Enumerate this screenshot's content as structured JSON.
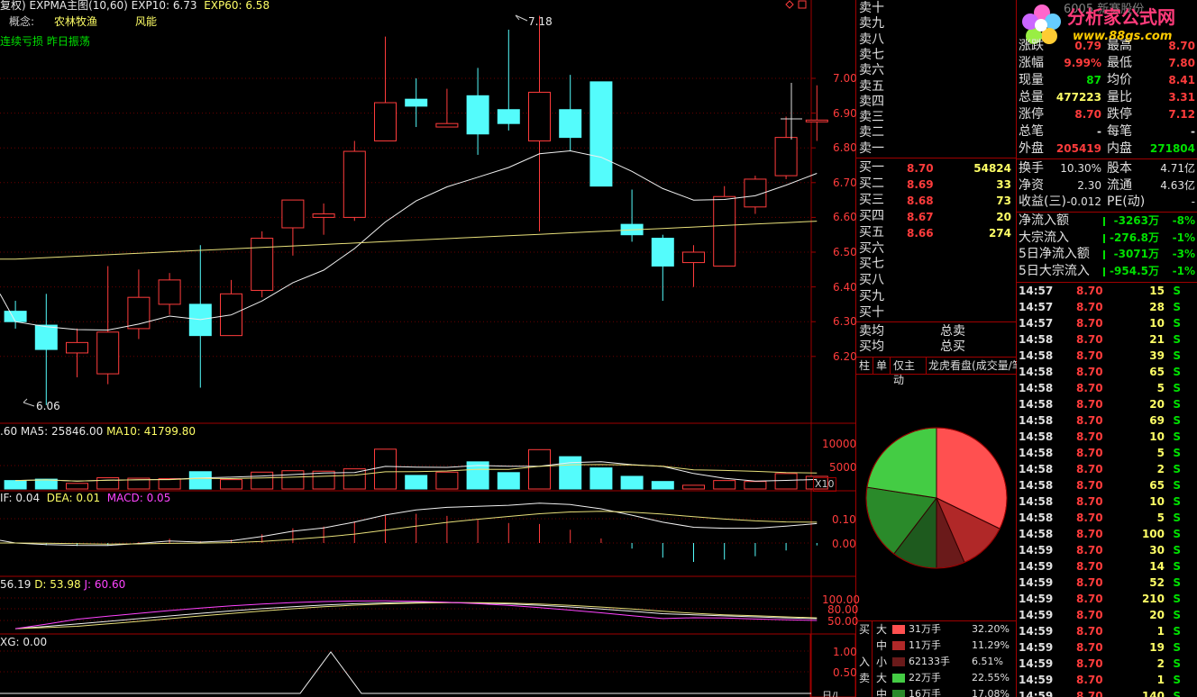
{
  "chart_header": {
    "title": "复权) EXPMA主图(10,60)",
    "exp10": "EXP10: 6.73",
    "exp60": "EXP60: 6.58",
    "concept_label": "概念:",
    "concept1": "农林牧渔",
    "concept2": "风能",
    "tag": "连续亏损 昨日振荡"
  },
  "price_axis": [
    "7.00",
    "6.90",
    "6.80",
    "6.70",
    "6.60",
    "6.50",
    "6.40",
    "6.30",
    "6.20"
  ],
  "high_label": "7.18",
  "low_label": "6.06",
  "volume_header": {
    "a": ".60",
    "ma5": "MA5: 25846.00",
    "ma10": "MA10: 41799.80"
  },
  "volume_axis": [
    "10000",
    "5000"
  ],
  "volume_unit": "X10",
  "macd_header": {
    "dif": "IF: 0.04",
    "dea": "DEA: 0.01",
    "macd": "MACD: 0.05"
  },
  "macd_axis": [
    "0.10",
    "0.00"
  ],
  "kdj_header": {
    "k": "56.19",
    "d": "D: 53.98",
    "j": "J: 60.60"
  },
  "kdj_axis": [
    "100.00",
    "80.00",
    "50.00"
  ],
  "xg_header": "XG: 0.00",
  "xg_axis": [
    "1.00",
    "0.50"
  ],
  "bottom_right_corner": "日/l",
  "sell_levels": [
    "卖十",
    "卖九",
    "卖八",
    "卖七",
    "卖六",
    "卖五",
    "卖四",
    "卖三",
    "卖二",
    "卖一"
  ],
  "buy_levels": [
    {
      "label": "买一",
      "price": "8.70",
      "vol": "54824"
    },
    {
      "label": "买二",
      "price": "8.69",
      "vol": "33"
    },
    {
      "label": "买三",
      "price": "8.68",
      "vol": "73"
    },
    {
      "label": "买四",
      "price": "8.67",
      "vol": "20"
    },
    {
      "label": "买五",
      "price": "8.66",
      "vol": "274"
    },
    {
      "label": "买六",
      "price": "",
      "vol": ""
    },
    {
      "label": "买七",
      "price": "",
      "vol": ""
    },
    {
      "label": "买八",
      "price": "",
      "vol": ""
    },
    {
      "label": "买九",
      "price": "",
      "vol": ""
    },
    {
      "label": "买十",
      "price": "",
      "vol": ""
    }
  ],
  "avg": {
    "sell_avg": "卖均",
    "sell_total": "总卖",
    "buy_avg": "买均",
    "buy_total": "总买"
  },
  "tabs": [
    "柱",
    "单",
    "仅主动",
    "龙虎看盘(成交量/笔"
  ],
  "flow_legend": [
    {
      "side": "买",
      "size": "大",
      "color": "#ff5050",
      "amount": "31万手",
      "pct": "32.20%"
    },
    {
      "side": "",
      "size": "中",
      "color": "#b02828",
      "amount": "11万手",
      "pct": "11.29%"
    },
    {
      "side": "入",
      "size": "小",
      "color": "#6a1a1a",
      "amount": "62133手",
      "pct": "6.51%"
    },
    {
      "side": "卖",
      "size": "大",
      "color": "#44cc44",
      "amount": "22万手",
      "pct": "22.55%"
    },
    {
      "side": "",
      "size": "中",
      "color": "#2a8a2a",
      "amount": "16万手",
      "pct": "17.08%"
    }
  ],
  "pie_values": [
    32.2,
    11.29,
    6.51,
    10.35,
    17.08,
    22.55
  ],
  "pie_colors": [
    "#ff5050",
    "#b02828",
    "#6a1a1a",
    "#1e5a1e",
    "#2a8a2a",
    "#44cc44"
  ],
  "logo": {
    "text": "分析家公式网",
    "url": "www.88gs.com",
    "back_text": "6005 新赛股份"
  },
  "quote": [
    {
      "l": "涨跌",
      "v": "0.79",
      "l2": "最高",
      "v2": "8.70"
    },
    {
      "l": "涨幅",
      "v": "9.99%",
      "l2": "最低",
      "v2": "7.80"
    },
    {
      "l": "现量",
      "v": "87",
      "l2": "均价",
      "v2": "8.41"
    },
    {
      "l": "总量",
      "v": "477223",
      "l2": "量比",
      "v2": "3.31"
    },
    {
      "l": "涨停",
      "v": "8.70",
      "l2": "跌停",
      "v2": "7.12"
    },
    {
      "l": "总笔",
      "v": "-",
      "l2": "每笔",
      "v2": "-"
    },
    {
      "l": "外盘",
      "v": "205419",
      "l2": "内盘",
      "v2": "271804"
    }
  ],
  "fundamentals": [
    {
      "l": "换手",
      "v": "10.30%",
      "l2": "股本",
      "v2": "4.71亿"
    },
    {
      "l": "净资",
      "v": "2.30",
      "l2": "流通",
      "v2": "4.63亿"
    },
    {
      "l": "收益(三)",
      "v": "-0.012",
      "l2": "PE(动)",
      "v2": "-"
    }
  ],
  "fund_flow": [
    {
      "l": "净流入额",
      "v": "-3263万",
      "p": "-8%"
    },
    {
      "l": "大宗流入",
      "v": "-276.8万",
      "p": "-1%"
    },
    {
      "l": "5日净流入额",
      "v": "-3071万",
      "p": "-3%"
    },
    {
      "l": "5日大宗流入",
      "v": "-954.5万",
      "p": "-1%"
    }
  ],
  "ticks": [
    {
      "t": "14:57",
      "p": "8.70",
      "v": "15",
      "s": "S"
    },
    {
      "t": "14:57",
      "p": "8.70",
      "v": "28",
      "s": "S"
    },
    {
      "t": "14:57",
      "p": "8.70",
      "v": "10",
      "s": "S"
    },
    {
      "t": "14:58",
      "p": "8.70",
      "v": "21",
      "s": "S"
    },
    {
      "t": "14:58",
      "p": "8.70",
      "v": "39",
      "s": "S"
    },
    {
      "t": "14:58",
      "p": "8.70",
      "v": "65",
      "s": "S"
    },
    {
      "t": "14:58",
      "p": "8.70",
      "v": "5",
      "s": "S"
    },
    {
      "t": "14:58",
      "p": "8.70",
      "v": "20",
      "s": "S"
    },
    {
      "t": "14:58",
      "p": "8.70",
      "v": "69",
      "s": "S"
    },
    {
      "t": "14:58",
      "p": "8.70",
      "v": "10",
      "s": "S"
    },
    {
      "t": "14:58",
      "p": "8.70",
      "v": "5",
      "s": "S"
    },
    {
      "t": "14:58",
      "p": "8.70",
      "v": "2",
      "s": "S"
    },
    {
      "t": "14:58",
      "p": "8.70",
      "v": "65",
      "s": "S"
    },
    {
      "t": "14:58",
      "p": "8.70",
      "v": "10",
      "s": "S"
    },
    {
      "t": "14:58",
      "p": "8.70",
      "v": "5",
      "s": "S"
    },
    {
      "t": "14:58",
      "p": "8.70",
      "v": "100",
      "s": "S"
    },
    {
      "t": "14:59",
      "p": "8.70",
      "v": "30",
      "s": "S"
    },
    {
      "t": "14:59",
      "p": "8.70",
      "v": "14",
      "s": "S"
    },
    {
      "t": "14:59",
      "p": "8.70",
      "v": "52",
      "s": "S"
    },
    {
      "t": "14:59",
      "p": "8.70",
      "v": "210",
      "s": "S"
    },
    {
      "t": "14:59",
      "p": "8.70",
      "v": "20",
      "s": "S"
    },
    {
      "t": "14:59",
      "p": "8.70",
      "v": "1",
      "s": "S"
    },
    {
      "t": "14:59",
      "p": "8.70",
      "v": "19",
      "s": "S"
    },
    {
      "t": "14:59",
      "p": "8.70",
      "v": "2",
      "s": "S"
    },
    {
      "t": "14:59",
      "p": "8.70",
      "v": "1",
      "s": "S"
    },
    {
      "t": "14:59",
      "p": "8.70",
      "v": "140",
      "s": "S"
    }
  ],
  "candles": [
    {
      "o": 6.33,
      "c": 6.3,
      "h": 6.36,
      "l": 6.28
    },
    {
      "o": 6.29,
      "c": 6.22,
      "h": 6.38,
      "l": 6.06
    },
    {
      "o": 6.21,
      "c": 6.24,
      "h": 6.28,
      "l": 6.14
    },
    {
      "o": 6.15,
      "c": 6.27,
      "h": 6.46,
      "l": 6.12
    },
    {
      "o": 6.28,
      "c": 6.37,
      "h": 6.45,
      "l": 6.25
    },
    {
      "o": 6.35,
      "c": 6.42,
      "h": 6.44,
      "l": 6.32
    },
    {
      "o": 6.35,
      "c": 6.26,
      "h": 6.52,
      "l": 6.11
    },
    {
      "o": 6.26,
      "c": 6.38,
      "h": 6.42,
      "l": 6.26
    },
    {
      "o": 6.39,
      "c": 6.54,
      "h": 6.56,
      "l": 6.37
    },
    {
      "o": 6.57,
      "c": 6.65,
      "h": 6.65,
      "l": 6.49
    },
    {
      "o": 6.6,
      "c": 6.61,
      "h": 6.64,
      "l": 6.55
    },
    {
      "o": 6.6,
      "c": 6.79,
      "h": 6.82,
      "l": 6.59
    },
    {
      "o": 6.82,
      "c": 6.93,
      "h": 7.12,
      "l": 6.82
    },
    {
      "o": 6.94,
      "c": 6.92,
      "h": 7.0,
      "l": 6.86
    },
    {
      "o": 6.86,
      "c": 6.87,
      "h": 6.97,
      "l": 6.86
    },
    {
      "o": 6.95,
      "c": 6.84,
      "h": 7.03,
      "l": 6.78
    },
    {
      "o": 6.91,
      "c": 6.87,
      "h": 7.14,
      "l": 6.85
    },
    {
      "o": 6.82,
      "c": 6.96,
      "h": 7.18,
      "l": 6.56
    },
    {
      "o": 6.91,
      "c": 6.83,
      "h": 7.01,
      "l": 6.79
    },
    {
      "o": 6.99,
      "c": 6.69,
      "h": 6.99,
      "l": 6.69
    },
    {
      "o": 6.58,
      "c": 6.55,
      "h": 6.68,
      "l": 6.53
    },
    {
      "o": 6.54,
      "c": 6.46,
      "h": 6.55,
      "l": 6.36
    },
    {
      "o": 6.47,
      "c": 6.5,
      "h": 6.52,
      "l": 6.4
    },
    {
      "o": 6.46,
      "c": 6.66,
      "h": 6.69,
      "l": 6.46
    },
    {
      "o": 6.63,
      "c": 6.71,
      "h": 6.72,
      "l": 6.61
    },
    {
      "o": 6.72,
      "c": 6.83,
      "h": 6.89,
      "l": 6.71
    },
    {
      "o": 6.88,
      "c": 6.88,
      "h": 6.98,
      "l": 6.82
    }
  ],
  "volumes": [
    1800,
    2100,
    1200,
    2400,
    2300,
    2200,
    3700,
    2000,
    3600,
    3900,
    3800,
    4300,
    8500,
    2900,
    3600,
    5800,
    3500,
    8400,
    6900,
    4500,
    2700,
    1600,
    800,
    1800,
    1600,
    3300,
    2700
  ]
}
